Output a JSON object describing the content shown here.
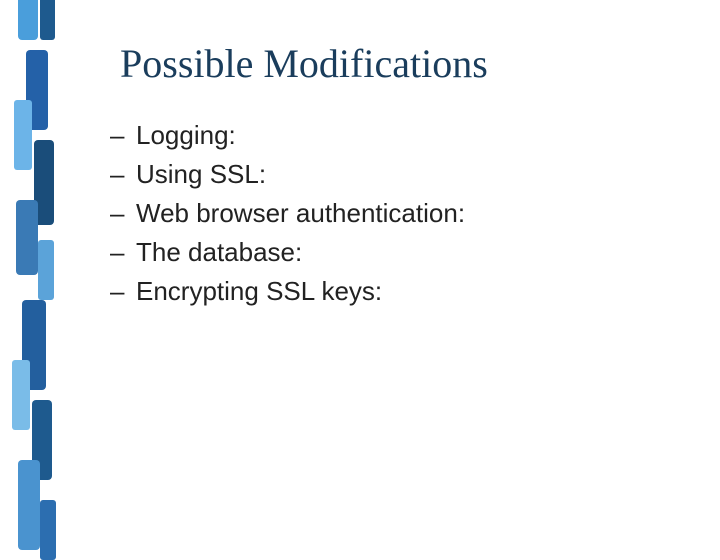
{
  "title": "Possible Modifications",
  "bullets": [
    {
      "text": "Logging:"
    },
    {
      "text": "Using SSL:"
    },
    {
      "text": "Web browser authentication:"
    },
    {
      "text": "The database:"
    },
    {
      "text": "Encrypting SSL keys:"
    }
  ],
  "dash": "–"
}
